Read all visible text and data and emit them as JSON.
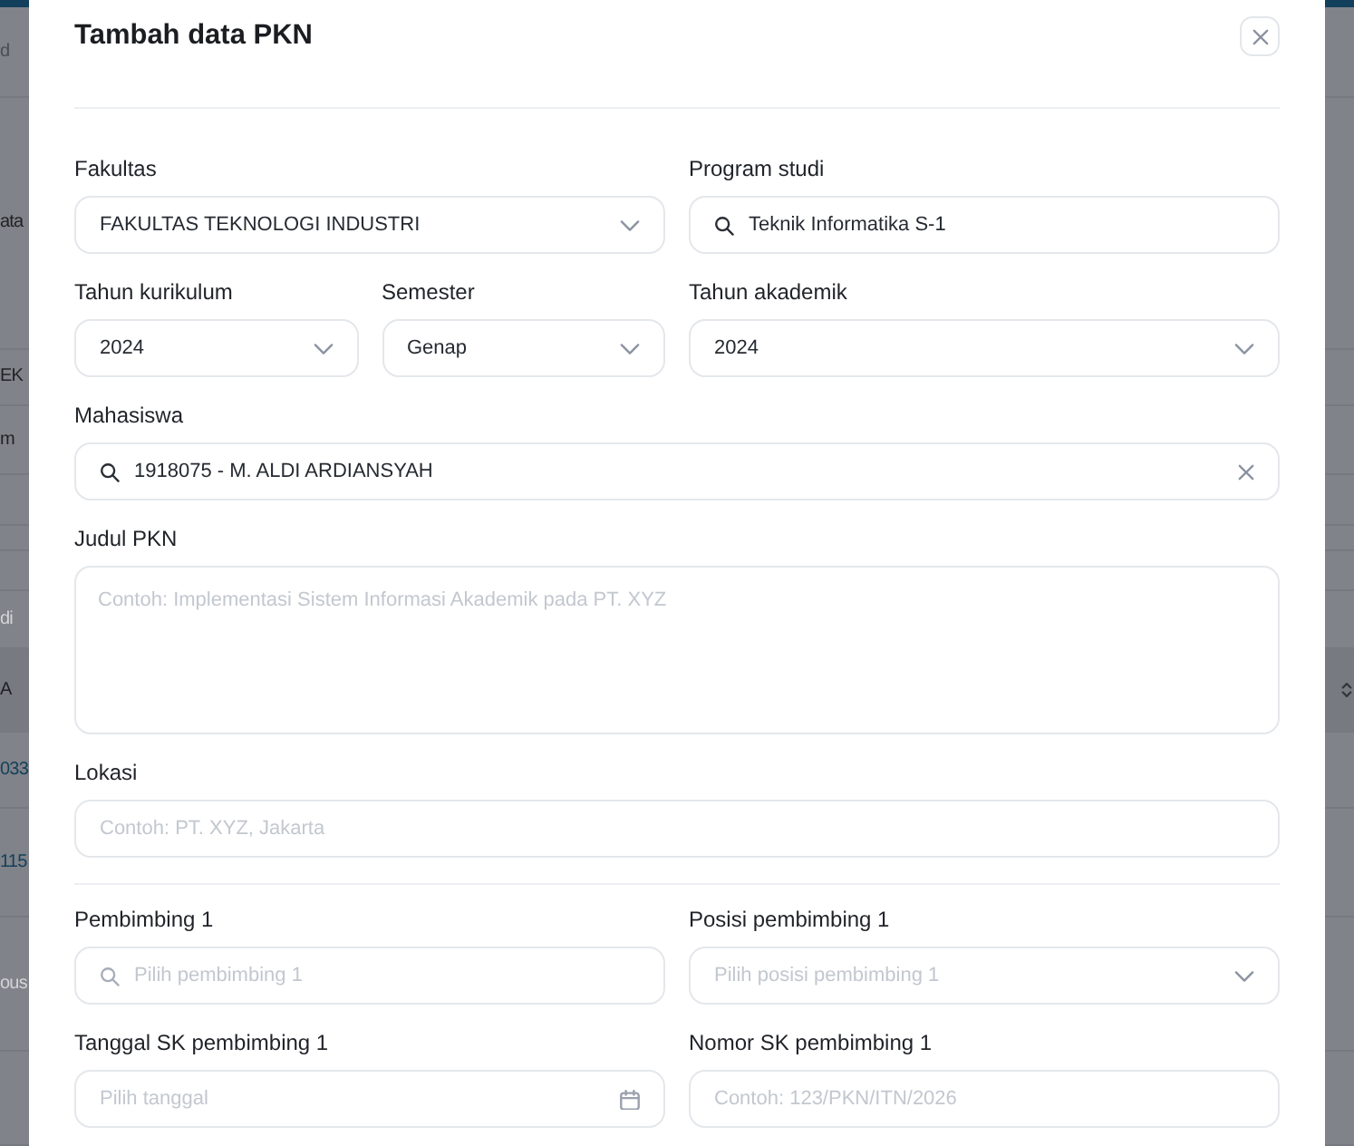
{
  "backdrop": {
    "left_edge": [
      {
        "text": "d",
        "kind": "muted"
      },
      {
        "text": "ata",
        "kind": "plain"
      },
      {
        "text": "EK",
        "kind": "plain"
      },
      {
        "text": "m",
        "kind": "plain"
      },
      {
        "text": "di",
        "kind": "placeholder"
      },
      {
        "text": "A",
        "kind": "header"
      },
      {
        "text": "033",
        "kind": "link"
      },
      {
        "text": "115",
        "kind": "link"
      },
      {
        "text": "ous",
        "kind": "placeholder"
      }
    ]
  },
  "dialog": {
    "title": "Tambah data PKN",
    "sections": [
      {
        "rows": [
          {
            "fields": [
              {
                "kind": "select",
                "label": "Fakultas",
                "value": "FAKULTAS TEKNOLOGI INDUSTRI"
              },
              {
                "kind": "search",
                "label": "Program studi",
                "value": "Teknik Informatika S-1",
                "clearable": false
              }
            ]
          },
          {
            "fields": [
              {
                "kind": "select",
                "label": "Tahun kurikulum",
                "value": "2024"
              },
              {
                "kind": "select",
                "label": "Semester",
                "value": "Genap"
              },
              {
                "kind": "select",
                "label": "Tahun akademik",
                "value": "2024"
              }
            ]
          },
          {
            "fields": [
              {
                "kind": "search",
                "label": "Mahasiswa",
                "value": "1918075 - M. ALDI ARDIANSYAH",
                "clearable": true
              }
            ]
          },
          {
            "fields": [
              {
                "kind": "textarea",
                "label": "Judul PKN",
                "placeholder": "Contoh: Implementasi Sistem Informasi Akademik pada PT. XYZ"
              }
            ]
          },
          {
            "fields": [
              {
                "kind": "text",
                "label": "Lokasi",
                "placeholder": "Contoh: PT. XYZ, Jakarta"
              }
            ]
          }
        ]
      },
      {
        "rows": [
          {
            "fields": [
              {
                "kind": "search",
                "label": "Pembimbing 1",
                "placeholder": "Pilih pembimbing 1",
                "clearable": false
              },
              {
                "kind": "select",
                "label": "Posisi pembimbing 1",
                "placeholder": "Pilih posisi pembimbing 1"
              }
            ]
          },
          {
            "fields": [
              {
                "kind": "date",
                "label": "Tanggal SK pembimbing 1",
                "placeholder": "Pilih tanggal"
              },
              {
                "kind": "text",
                "label": "Nomor SK pembimbing 1",
                "placeholder": "Contoh: 123/PKN/ITN/2026"
              }
            ]
          }
        ]
      }
    ]
  }
}
